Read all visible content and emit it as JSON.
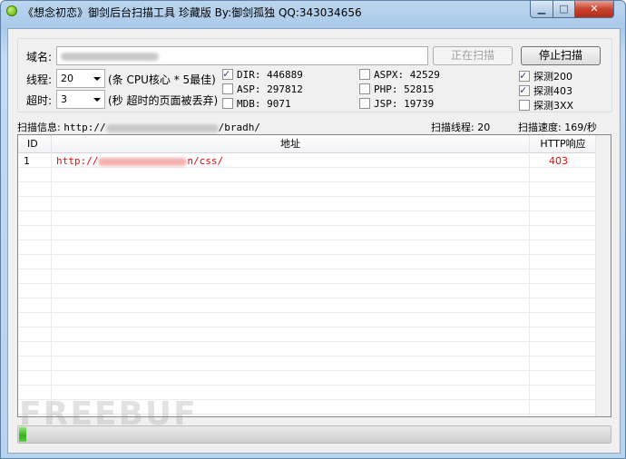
{
  "window": {
    "title": "《想念初恋》御剑后台扫描工具 珍藏版 By:御剑孤独 QQ:343034656",
    "controls": [
      "minimize-icon",
      "maximize-icon",
      "close-icon"
    ]
  },
  "form": {
    "domain_label": "域名:",
    "domain_value_visible": "",
    "threads_label": "线程:",
    "threads_value": "20",
    "threads_hint": "(条 CPU核心 * 5最佳)",
    "timeout_label": "超时:",
    "timeout_value": "3",
    "timeout_hint": "(秒 超时的页面被丢弃)",
    "scanning_button": "正在扫描",
    "stop_button": "停止扫描"
  },
  "dictionaries": [
    {
      "label": "DIR: 446889",
      "checked": true
    },
    {
      "label": "ASP: 297812",
      "checked": false
    },
    {
      "label": "MDB: 9071",
      "checked": false
    },
    {
      "label": "ASPX: 42529",
      "checked": false
    },
    {
      "label": "PHP: 52815",
      "checked": false
    },
    {
      "label": "JSP: 19739",
      "checked": false
    }
  ],
  "status_filters": [
    {
      "label": "探测200",
      "checked": true
    },
    {
      "label": "探测403",
      "checked": true
    },
    {
      "label": "探测3XX",
      "checked": false
    }
  ],
  "status": {
    "scan_info_label": "扫描信息:",
    "scan_info_prefix": "http://",
    "scan_info_suffix": "/bradh/",
    "threads_text": "扫描线程: 20",
    "speed_text": "扫描速度: 169/秒"
  },
  "results": {
    "columns": [
      "ID",
      "地址",
      "HTTP响应"
    ],
    "rows": [
      {
        "id": "1",
        "url_prefix": "http://",
        "url_suffix": "n/css/",
        "code": "403"
      }
    ]
  },
  "progress": {
    "fraction": 0.012
  },
  "watermark": "FREEBUF",
  "colors": {
    "result_text": "#ff0000",
    "progress_green": "#37b11c"
  }
}
